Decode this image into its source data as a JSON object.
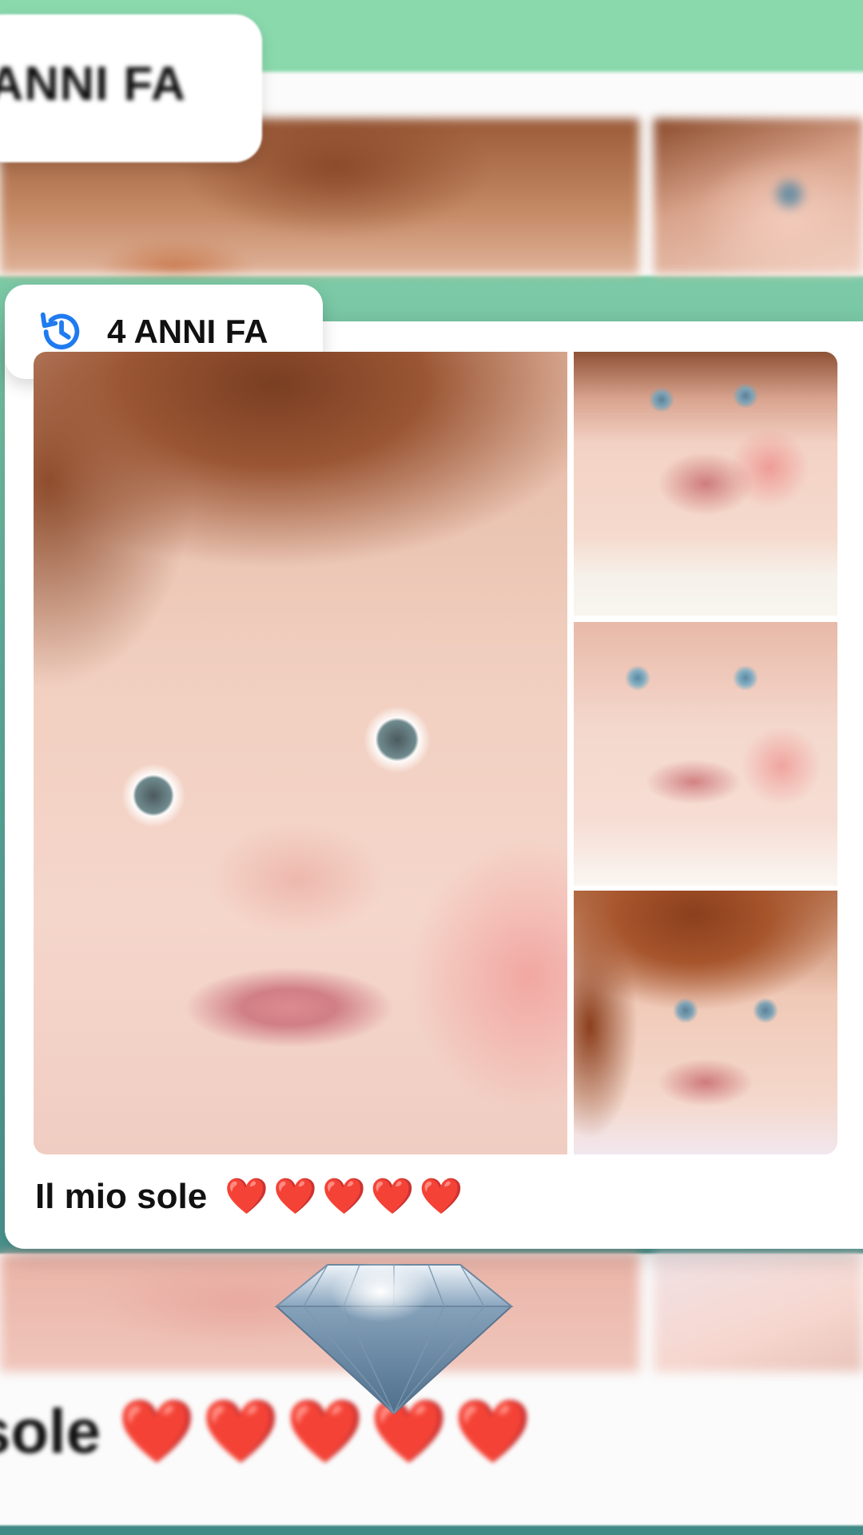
{
  "background": {
    "top_badge_text": "ANNI FA",
    "bottom_caption_text": "sole",
    "bottom_caption_hearts": "❤️❤️❤️❤️❤️"
  },
  "card": {
    "badge": {
      "icon": "history-icon",
      "label": "4 ANNI FA"
    },
    "photos": [
      {
        "id": "main",
        "alt": "baby close-up"
      },
      {
        "id": "side-1",
        "alt": "baby smiling"
      },
      {
        "id": "side-2",
        "alt": "baby smiling"
      },
      {
        "id": "side-3",
        "alt": "baby with red curls"
      }
    ],
    "caption": {
      "text": "Il mio sole",
      "hearts": "❤️❤️❤️❤️❤️"
    }
  },
  "overlay": {
    "sticker": "diamond-icon"
  },
  "colors": {
    "accent_blue": "#1f7bf0",
    "heart_red": "#e0141e",
    "bg_green": "#8ad9ad"
  }
}
